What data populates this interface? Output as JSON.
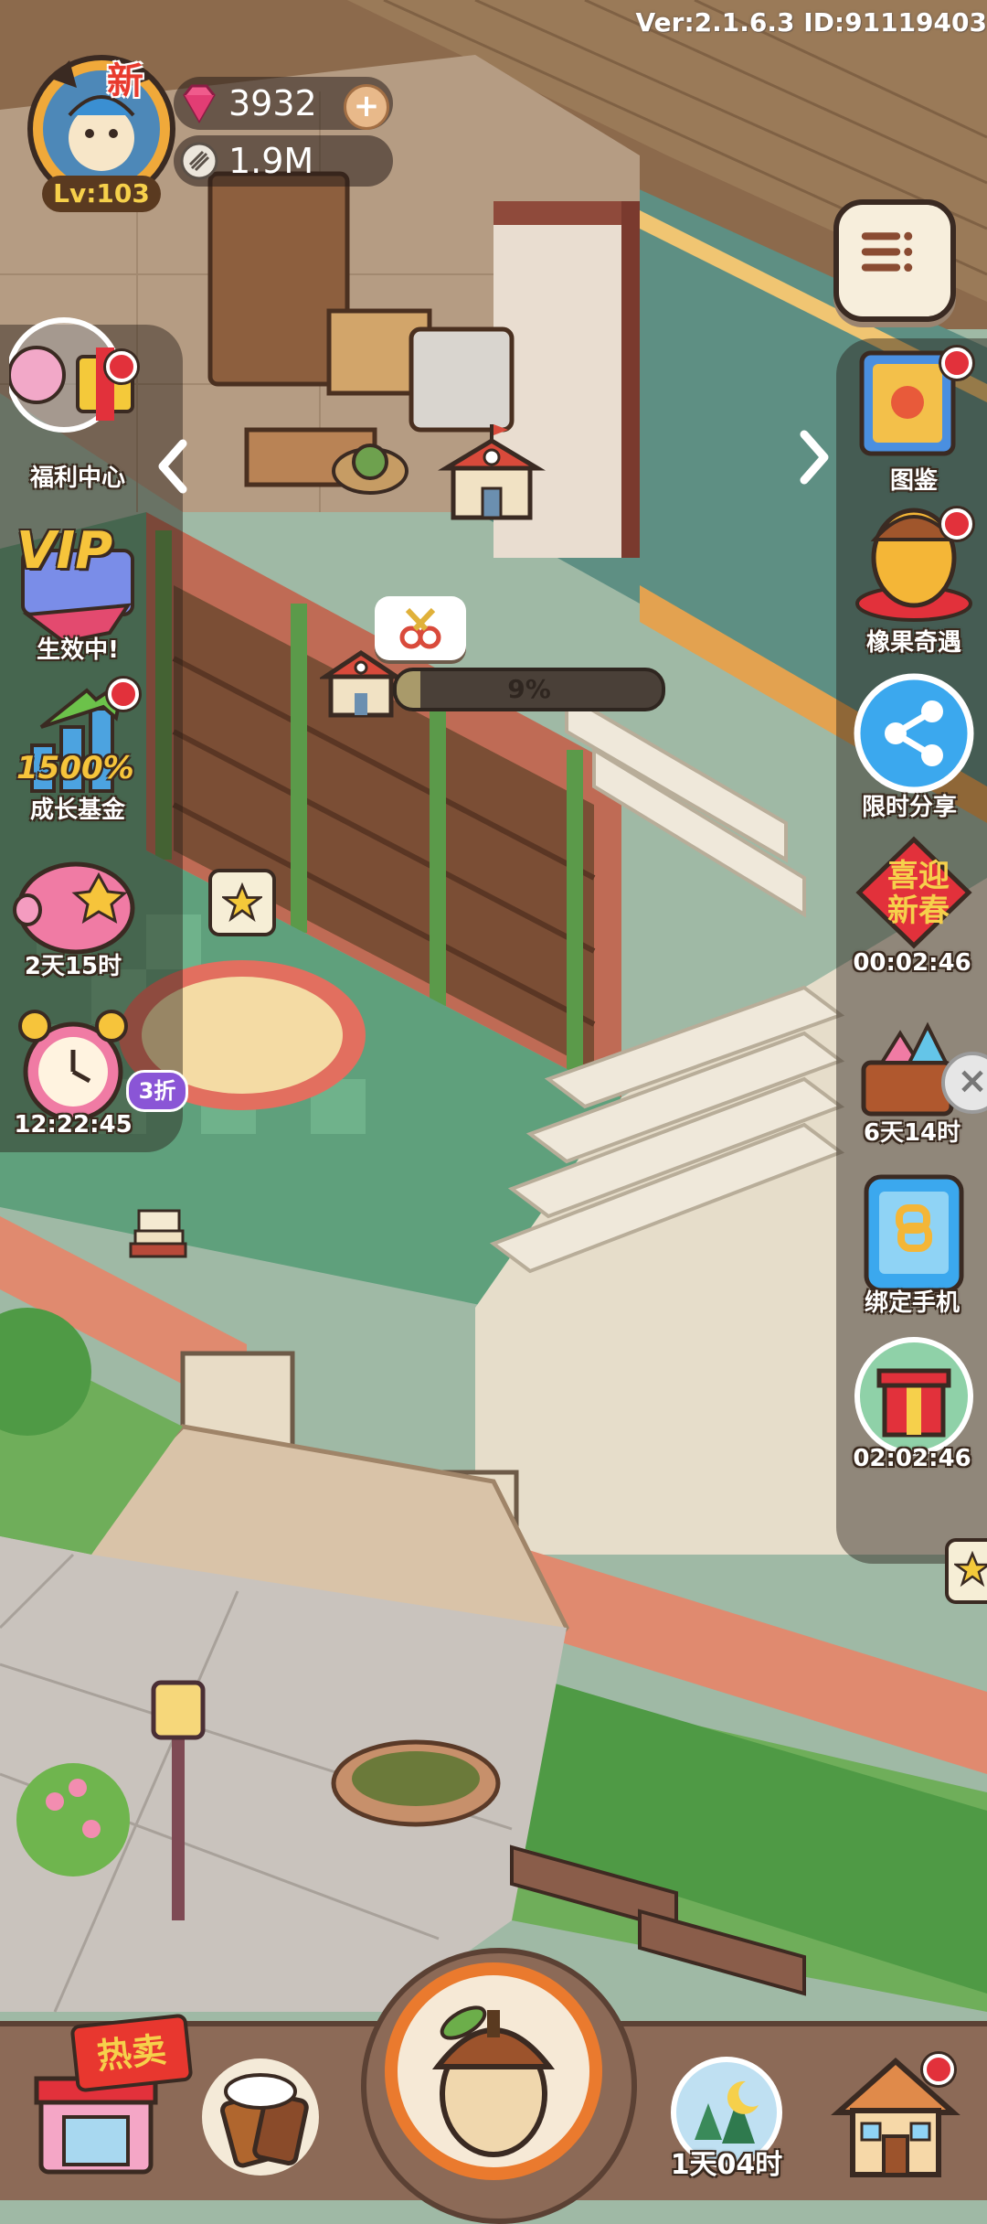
{
  "version": "Ver:2.1.6.3 ID:91119403",
  "profile": {
    "level": "Lv:103",
    "new_badge": "新"
  },
  "currencies": {
    "gems": "3932",
    "acorns": "1.9M"
  },
  "left_panel": [
    {
      "label": "福利中心"
    },
    {
      "label": "生效中!",
      "badge": "VIP"
    },
    {
      "label": "成长基金",
      "badge": "1500%"
    },
    {
      "label": "2天15时"
    },
    {
      "label": "12:22:45",
      "tag": "3折"
    }
  ],
  "right_panel": [
    {
      "label": "图鉴"
    },
    {
      "label": "橡果奇遇"
    },
    {
      "label": "限时分享"
    },
    {
      "label": "00:02:46",
      "badge_top": "喜迎",
      "badge_bottom": "新春"
    },
    {
      "label": "6天14时"
    },
    {
      "label": "绑定手机"
    },
    {
      "label": "02:02:46"
    }
  ],
  "build_progress": {
    "value": 0.09,
    "label": "9%"
  },
  "bottom_bar": {
    "shop_tag": "热卖",
    "timer": "1天04时"
  },
  "colors": {
    "accent_red": "#e2313b",
    "panel_bg": "rgba(40,30,25,0.55)",
    "progress_fill": "#a99a6a"
  }
}
